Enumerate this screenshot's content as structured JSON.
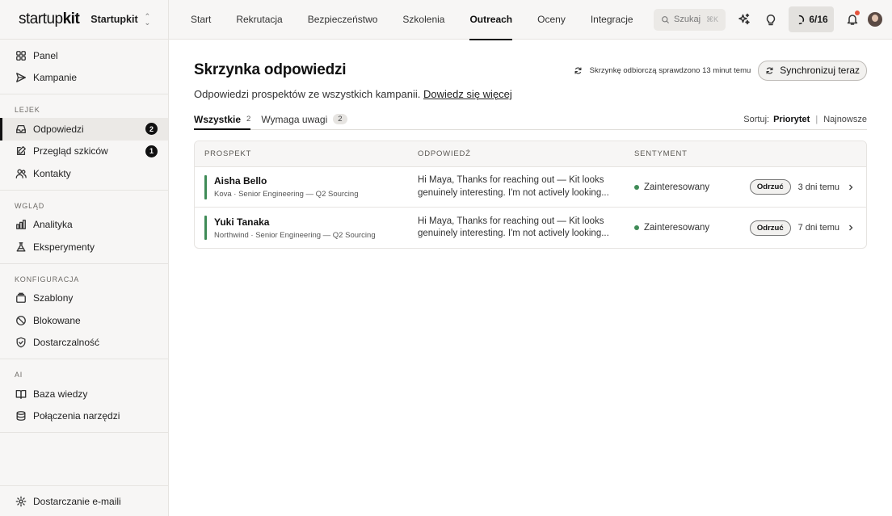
{
  "brand": {
    "logo_light": "startup",
    "logo_bold": "kit",
    "workspace": "Startupkit"
  },
  "sidebar": {
    "top": [
      {
        "label": "Panel",
        "icon": "grid-icon"
      },
      {
        "label": "Kampanie",
        "icon": "send-icon"
      }
    ],
    "groups": [
      {
        "title": "LEJEK",
        "items": [
          {
            "label": "Odpowiedzi",
            "icon": "inbox-icon",
            "badge": "2",
            "active": true
          },
          {
            "label": "Przegląd szkiców",
            "icon": "edit-icon",
            "badge": "1"
          },
          {
            "label": "Kontakty",
            "icon": "users-icon"
          }
        ]
      },
      {
        "title": "WGLĄD",
        "items": [
          {
            "label": "Analityka",
            "icon": "bar-chart-icon"
          },
          {
            "label": "Eksperymenty",
            "icon": "flask-icon"
          }
        ]
      },
      {
        "title": "KONFIGURACJA",
        "items": [
          {
            "label": "Szablony",
            "icon": "templates-icon"
          },
          {
            "label": "Blokowane",
            "icon": "block-icon"
          },
          {
            "label": "Dostarczalność",
            "icon": "shield-icon"
          }
        ]
      },
      {
        "title": "AI",
        "items": [
          {
            "label": "Baza wiedzy",
            "icon": "book-icon"
          },
          {
            "label": "Połączenia narzędzi",
            "icon": "database-icon"
          }
        ]
      }
    ],
    "footer": {
      "label": "Dostarczanie e-maili",
      "icon": "gear-icon"
    }
  },
  "topnav": {
    "tabs": [
      "Start",
      "Rekrutacja",
      "Bezpieczeństwo",
      "Szkolenia",
      "Outreach",
      "Oceny",
      "Integracje"
    ],
    "active": "Outreach",
    "search_placeholder": "Szukaj",
    "search_shortcut": "⌘K",
    "progress": "6/16"
  },
  "page": {
    "title": "Skrzynka odpowiedzi",
    "sync_status": "Skrzynkę odbiorczą sprawdzono 13 minut temu",
    "sync_button": "Synchronizuj teraz",
    "subtitle": "Odpowiedzi prospektów ze wszystkich kampanii.",
    "learn_more": "Dowiedz się więcej",
    "filters": [
      {
        "label": "Wszystkie",
        "count": "2",
        "active": true
      },
      {
        "label": "Wymaga uwagi",
        "count": "2"
      }
    ],
    "sort_label": "Sortuj:",
    "sort_options": [
      "Priorytet",
      "Najnowsze"
    ],
    "sort_active": "Priorytet"
  },
  "table": {
    "headers": [
      "PROSPEKT",
      "ODPOWIEDŹ",
      "SENTYMENT"
    ],
    "rows": [
      {
        "name": "Aisha Bello",
        "meta": "Kova · Senior Engineering — Q2 Sourcing",
        "reply": "Hi Maya, Thanks for reaching out — Kit looks genuinely interesting. I'm not actively looking...",
        "sentiment": "Zainteresowany",
        "action": "Odrzuć",
        "time": "3 dni temu"
      },
      {
        "name": "Yuki Tanaka",
        "meta": "Northwind · Senior Engineering — Q2 Sourcing",
        "reply": "Hi Maya, Thanks for reaching out — Kit looks genuinely interesting. I'm not actively looking...",
        "sentiment": "Zainteresowany",
        "action": "Odrzuć",
        "time": "7 dni temu"
      }
    ]
  },
  "colors": {
    "accent_green": "#3f8b57",
    "notif_red": "#e5533c",
    "sidebar_bg": "#f7f6f5"
  }
}
